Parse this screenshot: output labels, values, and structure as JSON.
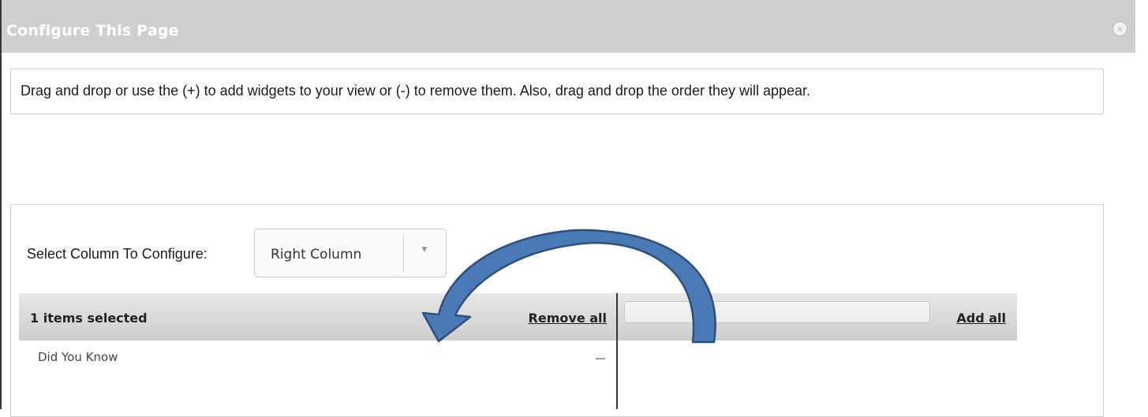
{
  "dialog": {
    "title": "Configure This Page",
    "close_icon": "close-circle-icon",
    "close_glyph": "×",
    "instructions": "Drag and drop or use the (+) to add widgets to your view or (-) to remove them. Also, drag and drop the order they will appear."
  },
  "column_select": {
    "label": "Select Column To Configure:",
    "selected": "Right Column",
    "arrow_glyph": "▼"
  },
  "selected_list": {
    "header": "1 items selected",
    "remove_all_label": "Remove all",
    "items": [
      {
        "label": "Did You Know",
        "action_icon": "minus-icon"
      }
    ]
  },
  "available_list": {
    "search_value": "",
    "add_all_label": "Add all"
  },
  "annotation": {
    "arrow_icon": "curved-arrow-icon",
    "fill_color": "#4a7ab5",
    "stroke_color": "#2d4f7a"
  },
  "colors": {
    "titlebar": "#cfcfcf",
    "header_gradient_top": "#e8e8e8",
    "header_gradient_bottom": "#cdcdcd"
  }
}
